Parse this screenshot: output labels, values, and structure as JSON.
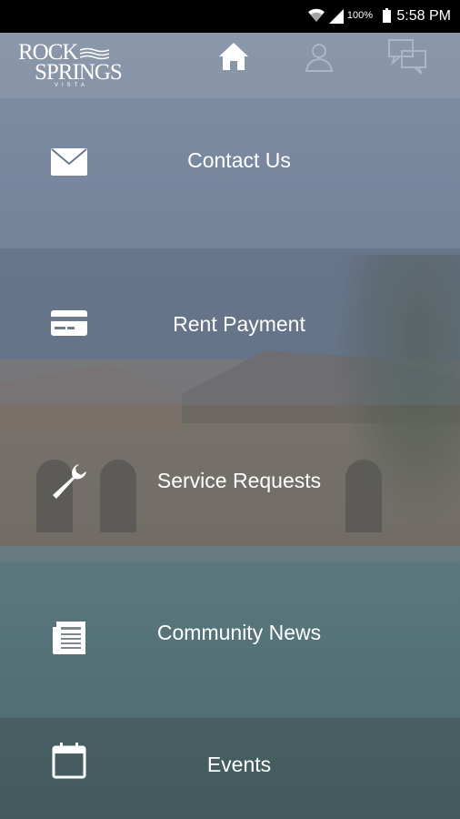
{
  "status_bar": {
    "battery": "100%",
    "time": "5:58 PM",
    "icons": [
      "wifi-icon",
      "signal-icon",
      "battery-icon"
    ]
  },
  "header": {
    "logo_line1": "ROCK",
    "logo_line2": "SPRINGS",
    "logo_line3": "VISTA",
    "nav_icons": [
      "home-icon",
      "profile-icon",
      "chat-icon"
    ]
  },
  "menu": {
    "items": [
      {
        "label": "Contact Us",
        "icon": "envelope-icon"
      },
      {
        "label": "Rent Payment",
        "icon": "credit-card-icon"
      },
      {
        "label": "Service Requests",
        "icon": "wrench-icon"
      },
      {
        "label": "Community News",
        "icon": "newspaper-icon"
      },
      {
        "label": "Events",
        "icon": "calendar-icon"
      }
    ]
  },
  "colors": {
    "status_bar": "#000000",
    "text": "#ffffff",
    "inactive_icon": "#aeb6c4"
  }
}
